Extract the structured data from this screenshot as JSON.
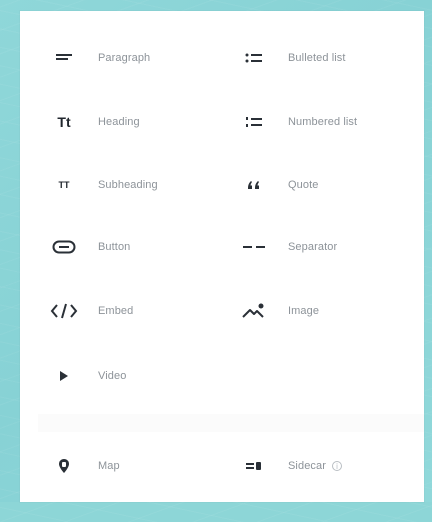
{
  "blocks": [
    {
      "label": "Paragraph",
      "icon": "paragraph-icon"
    },
    {
      "label": "Bulleted list",
      "icon": "bulleted-list-icon"
    },
    {
      "label": "Heading",
      "icon": "heading-icon"
    },
    {
      "label": "Numbered list",
      "icon": "numbered-list-icon"
    },
    {
      "label": "Subheading",
      "icon": "subheading-icon"
    },
    {
      "label": "Quote",
      "icon": "quote-icon"
    },
    {
      "label": "Button",
      "icon": "button-icon"
    },
    {
      "label": "Separator",
      "icon": "separator-icon"
    },
    {
      "label": "Embed",
      "icon": "embed-icon"
    },
    {
      "label": "Image",
      "icon": "image-icon"
    },
    {
      "label": "Video",
      "icon": "video-icon"
    }
  ],
  "secondary_blocks": [
    {
      "label": "Map",
      "icon": "map-icon"
    },
    {
      "label": "Sidecar",
      "icon": "sidecar-icon",
      "info_icon": "info-icon"
    }
  ],
  "glyphs": {
    "heading": "Tt",
    "subheading": "TT",
    "info": "i"
  },
  "colors": {
    "background": "#8dd6d7",
    "panel": "#ffffff",
    "label": "#8d9399",
    "icon": "#20262d"
  }
}
